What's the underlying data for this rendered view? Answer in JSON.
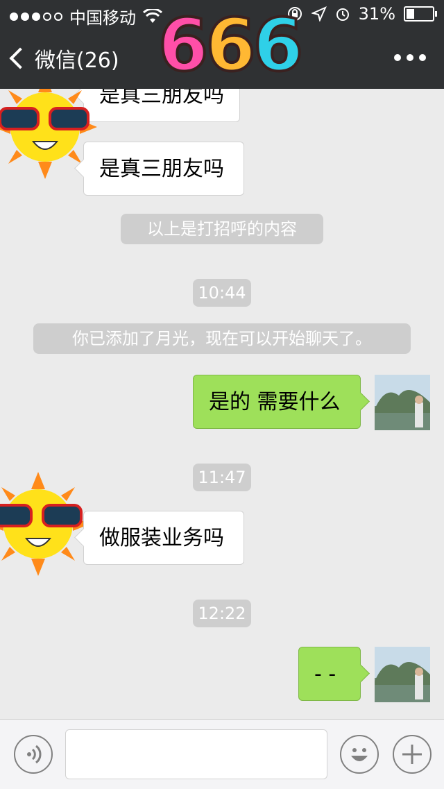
{
  "status_bar": {
    "carrier": "中国移动",
    "battery": "31%",
    "battery_level": 0.31
  },
  "nav": {
    "back_label": "微信(26)"
  },
  "sticker": {
    "text": "666"
  },
  "messages": [
    {
      "type": "in",
      "text": "是真三朋友吗"
    },
    {
      "type": "in",
      "text": "是真三朋友吗"
    },
    {
      "type": "system",
      "text": "以上是打招呼的内容"
    },
    {
      "type": "time",
      "text": "10:44"
    },
    {
      "type": "system",
      "text": "你已添加了月光，现在可以开始聊天了。"
    },
    {
      "type": "out",
      "text": "是的 需要什么"
    },
    {
      "type": "time",
      "text": "11:47"
    },
    {
      "type": "in",
      "text": "做服装业务吗"
    },
    {
      "type": "time",
      "text": "12:22"
    },
    {
      "type": "out",
      "text": "- -"
    }
  ],
  "colors": {
    "header_bg": "#2f3133",
    "chat_bg": "#ebebeb",
    "outgoing_bubble": "#9ee05a",
    "incoming_bubble": "#ffffff",
    "pill_bg": "#cecece"
  },
  "icons": {
    "signal": "signal-dots-icon",
    "wifi": "wifi-icon",
    "lock": "rotation-lock-icon",
    "location": "location-arrow-icon",
    "alarm": "alarm-icon",
    "back": "chevron-left-icon",
    "more": "more-dots-icon",
    "voice": "voice-icon",
    "emoji": "emoji-icon",
    "plus": "plus-icon"
  }
}
